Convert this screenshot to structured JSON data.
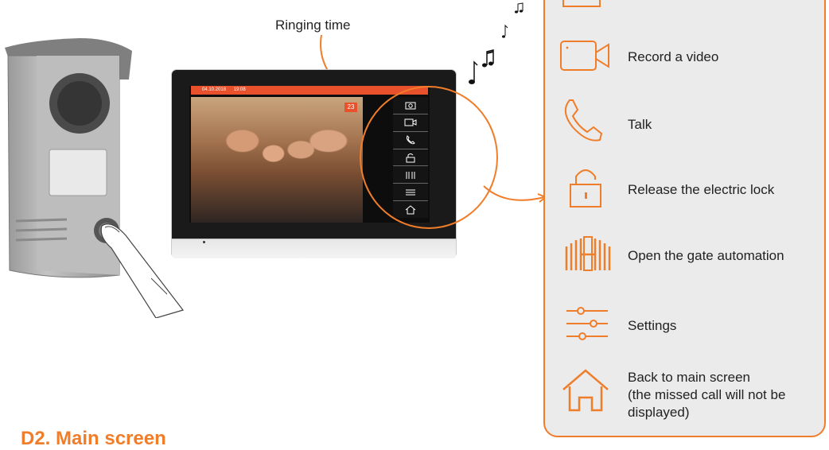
{
  "callout": {
    "ringing_time": "Ringing time"
  },
  "monitor": {
    "date": "04.10.2018",
    "time": "19:08",
    "ring_counter": "23"
  },
  "legend": {
    "items": [
      {
        "icon": "video-camera-icon",
        "label": "Record a video"
      },
      {
        "icon": "phone-icon",
        "label": "Talk"
      },
      {
        "icon": "padlock-icon",
        "label": "Release the electric lock"
      },
      {
        "icon": "gate-icon",
        "label": "Open the gate automation"
      },
      {
        "icon": "sliders-icon",
        "label": "Settings"
      },
      {
        "icon": "home-icon",
        "label_line1": "Back to main screen",
        "label_line2": "(the missed call will not be",
        "label_line3": "displayed)"
      }
    ]
  },
  "section_heading": "D2. Main screen",
  "colors": {
    "accent": "#f07d2a",
    "status_bar": "#e8512b"
  }
}
